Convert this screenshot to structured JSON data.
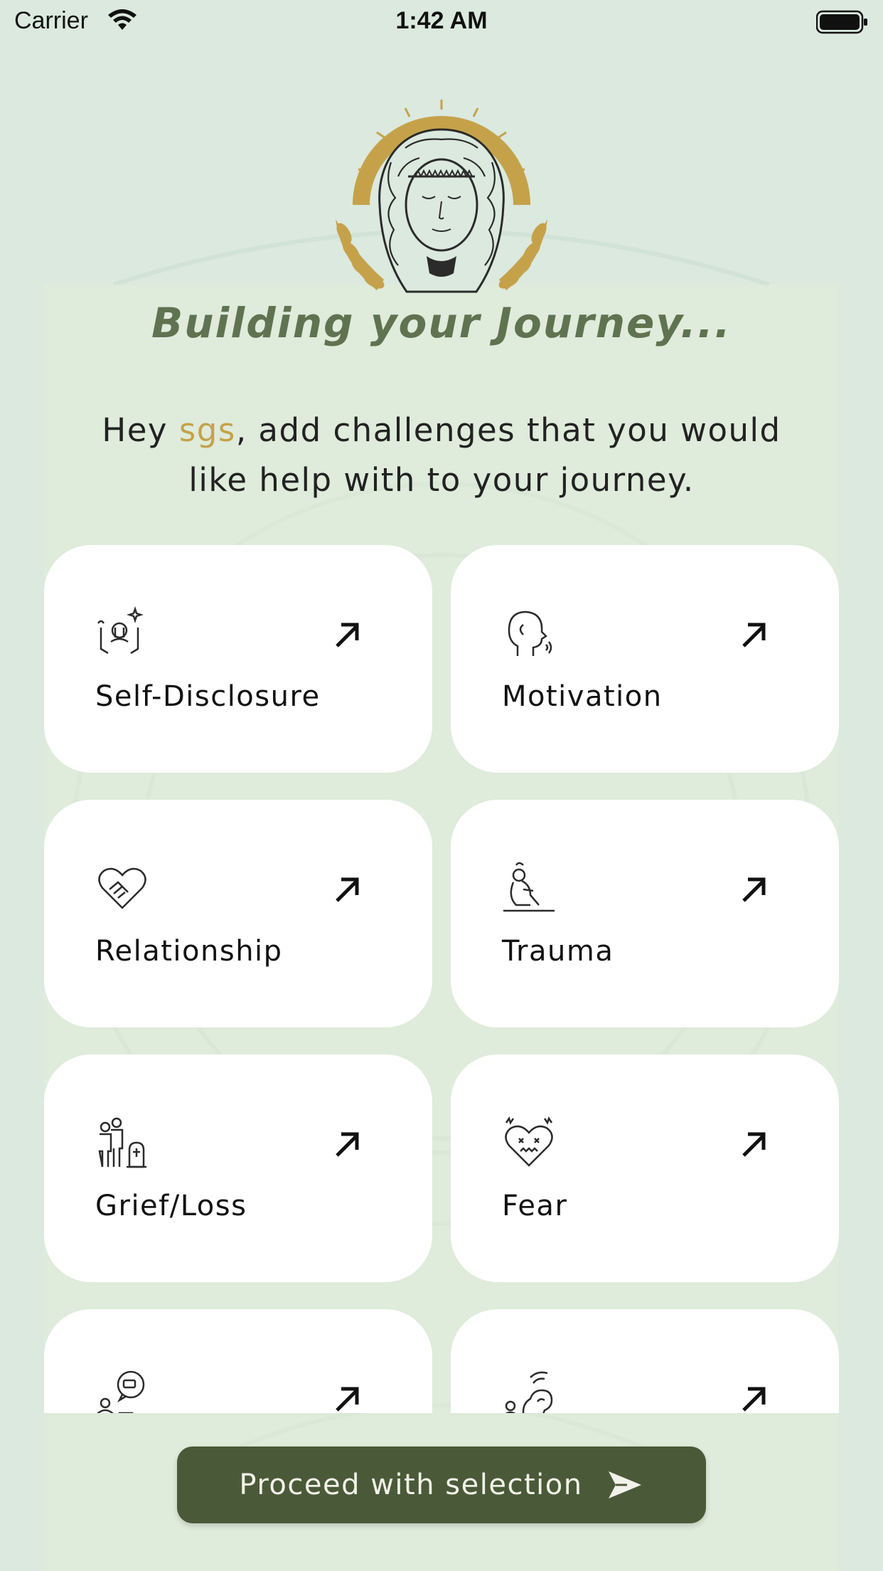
{
  "status_bar": {
    "carrier": "Carrier",
    "time": "1:42 AM"
  },
  "header": {
    "title": "Building your Journey...",
    "greeting_prefix": "Hey ",
    "user_name": "sgs",
    "greeting_suffix": ", add challenges that you would like help with to your journey."
  },
  "challenges": [
    {
      "label": "Self-Disclosure",
      "icon": "self-disclosure-icon"
    },
    {
      "label": "Motivation",
      "icon": "motivation-icon"
    },
    {
      "label": "Relationship",
      "icon": "relationship-icon"
    },
    {
      "label": "Trauma",
      "icon": "trauma-icon"
    },
    {
      "label": "Grief/Loss",
      "icon": "grief-loss-icon"
    },
    {
      "label": "Fear",
      "icon": "fear-icon"
    },
    {
      "label": "",
      "icon": "communication-icon"
    },
    {
      "label": "",
      "icon": "listening-icon"
    }
  ],
  "proceed_button": {
    "label": "Proceed with selection",
    "icon": "send-icon"
  },
  "colors": {
    "background": "#dbe9df",
    "accent_gold": "#c5a24a",
    "title_green": "#5f7350",
    "button": "#4a5a38"
  }
}
